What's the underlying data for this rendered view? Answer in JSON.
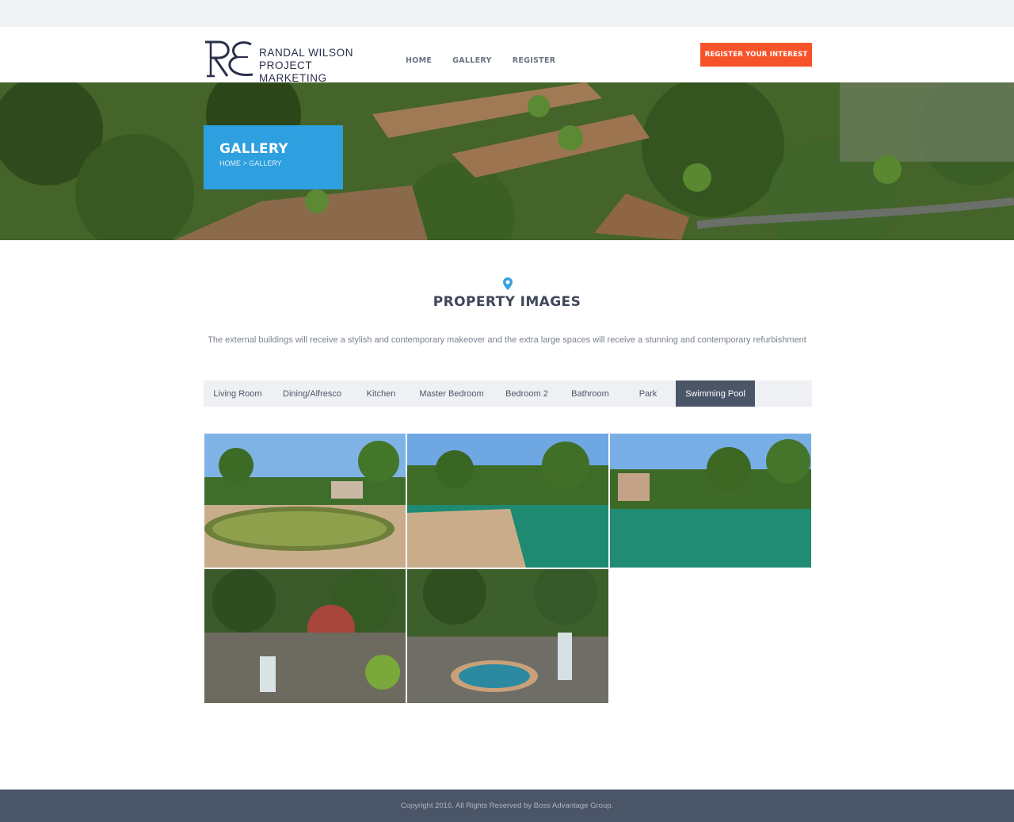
{
  "brand": {
    "line1": "RANDAL WILSON",
    "line2": "PROJECT MARKETING",
    "mark_icon": "re-monogram-logo",
    "color": "#2a2f4a"
  },
  "nav": {
    "items": [
      {
        "label": "HOME"
      },
      {
        "label": "GALLERY"
      },
      {
        "label": "REGISTER"
      }
    ]
  },
  "cta": {
    "label": "REGISTER YOUR INTEREST",
    "color": "#f7532a"
  },
  "hero": {
    "title": "GALLERY",
    "breadcrumb": "HOME > GALLERY",
    "box_color": "#2e9fdf",
    "background": "aerial-resort-photo"
  },
  "section": {
    "icon": "map-pin-icon",
    "title": "PROPERTY IMAGES",
    "description": "The external buildings will receive a stylish and contemporary makeover and the extra large spaces will receive a stunning and contemporary refurbishment"
  },
  "tabs": {
    "items": [
      {
        "label": "Living Room"
      },
      {
        "label": "Dining/Alfresco"
      },
      {
        "label": "Kitchen"
      },
      {
        "label": "Master Bedroom"
      },
      {
        "label": "Bedroom 2"
      },
      {
        "label": "Bathroom"
      },
      {
        "label": "Park"
      },
      {
        "label": "Swimming Pool"
      }
    ],
    "active": "Swimming Pool",
    "active_color": "#4a5568"
  },
  "gallery": {
    "photos": [
      {
        "subject": "pool-photo-1"
      },
      {
        "subject": "pool-photo-2"
      },
      {
        "subject": "pool-photo-3"
      },
      {
        "subject": "waterfall-garden-photo"
      },
      {
        "subject": "spa-waterfall-photo"
      }
    ]
  },
  "footer": {
    "copyright": "Copyright 2016. All Rights Reserved by Boss Advantage Group.",
    "color": "#4a5568"
  }
}
